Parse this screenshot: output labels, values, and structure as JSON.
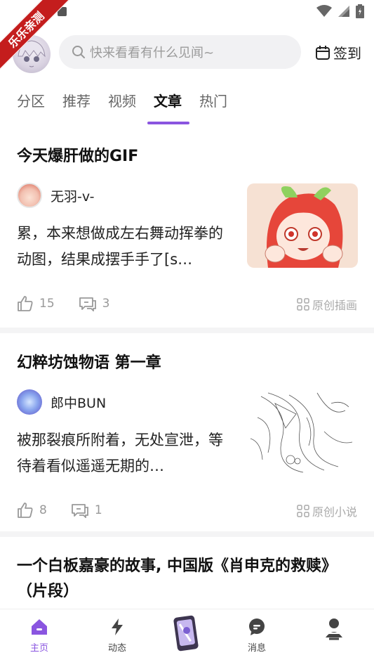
{
  "watermark": "乐乐亲测",
  "search": {
    "placeholder": "快来看看有什么见闻~"
  },
  "signin_label": "签到",
  "tabs": [
    {
      "label": "分区"
    },
    {
      "label": "推荐"
    },
    {
      "label": "视频"
    },
    {
      "label": "文章",
      "active": true
    },
    {
      "label": "热门"
    }
  ],
  "accent_color": "#8a55e0",
  "posts": [
    {
      "title": "今天爆肝做的GIF",
      "author": "无羽-v-",
      "excerpt": "累，本来想做成左右舞动挥拳的动图，结果成摆手手了[s…",
      "likes": "15",
      "comments": "3",
      "tag": "原创插画"
    },
    {
      "title": "幻粹坊蚀物语 第一章",
      "author": "郎中BUN",
      "excerpt": " 被那裂痕所附着，无处宣泄，等待着看似遥遥无期的…",
      "likes": "8",
      "comments": "1",
      "tag": "原创小说"
    },
    {
      "title": "一个白板嘉豪的故事, 中国版《肖申克的救赎》（片段）"
    }
  ],
  "bottom_nav": [
    {
      "label": "主页",
      "icon": "home-icon",
      "active": true
    },
    {
      "label": "动态",
      "icon": "lightning-icon"
    },
    {
      "label": "",
      "icon": "center-app-icon"
    },
    {
      "label": "消息",
      "icon": "message-icon"
    },
    {
      "label": "",
      "icon": "profile-icon"
    }
  ]
}
